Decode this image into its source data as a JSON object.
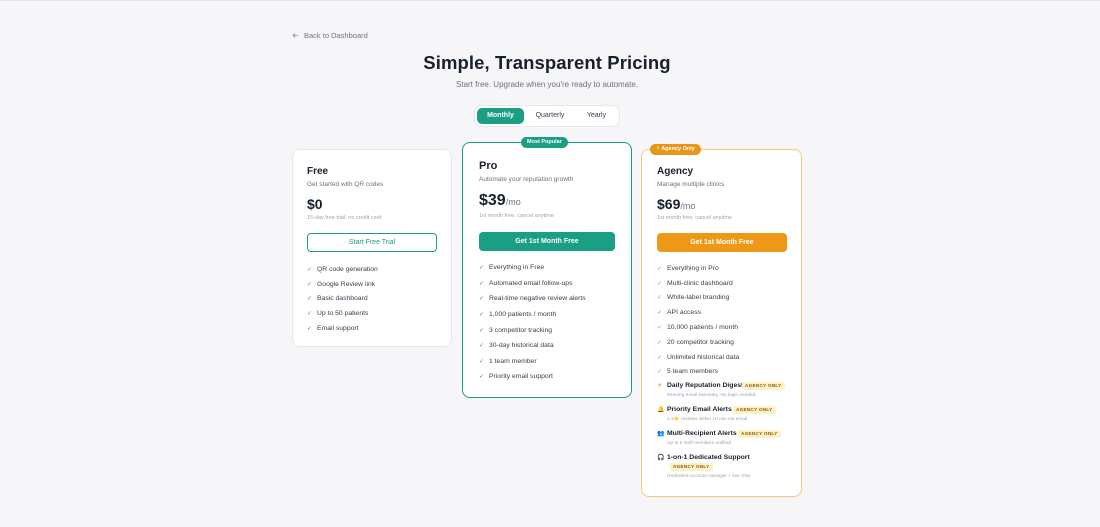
{
  "nav": {
    "back_label": "Back to Dashboard"
  },
  "header": {
    "title": "Simple, Transparent Pricing",
    "subtitle": "Start free. Upgrade when you're ready to automate."
  },
  "billing_toggle": {
    "options": [
      "Monthly",
      "Quarterly",
      "Yearly"
    ],
    "selected": "Monthly"
  },
  "plans": {
    "free": {
      "name": "Free",
      "description": "Get started with QR codes",
      "price": "$0",
      "price_note": "15-day free trial, no credit card",
      "cta": "Start Free Trial",
      "features": [
        "QR code generation",
        "Google Review link",
        "Basic dashboard",
        "Up to 50 patients",
        "Email support"
      ]
    },
    "pro": {
      "badge": "Most Popular",
      "name": "Pro",
      "description": "Automate your reputation growth",
      "price": "$39",
      "period": "/mo",
      "price_note": "1st month free, cancel anytime",
      "cta": "Get 1st Month Free",
      "features": [
        "Everything in Free",
        "Automated email follow-ups",
        "Real-time negative review alerts",
        "1,000 patients / month",
        "3 competitor tracking",
        "30-day historical data",
        "1 team member",
        "Priority email support"
      ]
    },
    "agency": {
      "badge": "Agency Only",
      "name": "Agency",
      "description": "Manage multiple clinics",
      "price": "$69",
      "period": "/mo",
      "price_note": "1st month free, cancel anytime",
      "cta": "Get 1st Month Free",
      "features": [
        "Everything in Pro",
        "Multi-clinic dashboard",
        "White-label branding",
        "API access",
        "10,000 patients / month",
        "20 competitor tracking",
        "Unlimited historical data",
        "5 team members"
      ],
      "extras": [
        {
          "title": "Daily Reputation Digest",
          "tag": "AGENCY ONLY",
          "sub": "Morning email summary. No login needed.",
          "icon": "sun-icon"
        },
        {
          "title": "Priority Email Alerts",
          "tag": "AGENCY ONLY",
          "sub": "1-2⭐ reviews within 10 min via email",
          "icon": "bell-icon"
        },
        {
          "title": "Multi-Recipient Alerts",
          "tag": "AGENCY ONLY",
          "sub": "Up to 5 staff members notified",
          "icon": "users-icon"
        },
        {
          "title": "1-on-1 Dedicated Support",
          "tag": "AGENCY ONLY",
          "sub": "Dedicated account manager + live chat",
          "icon": "headset-icon"
        }
      ]
    }
  },
  "colors": {
    "accent": "#1a9e84",
    "agency": "#ee9818",
    "background": "#f6f6f8"
  }
}
